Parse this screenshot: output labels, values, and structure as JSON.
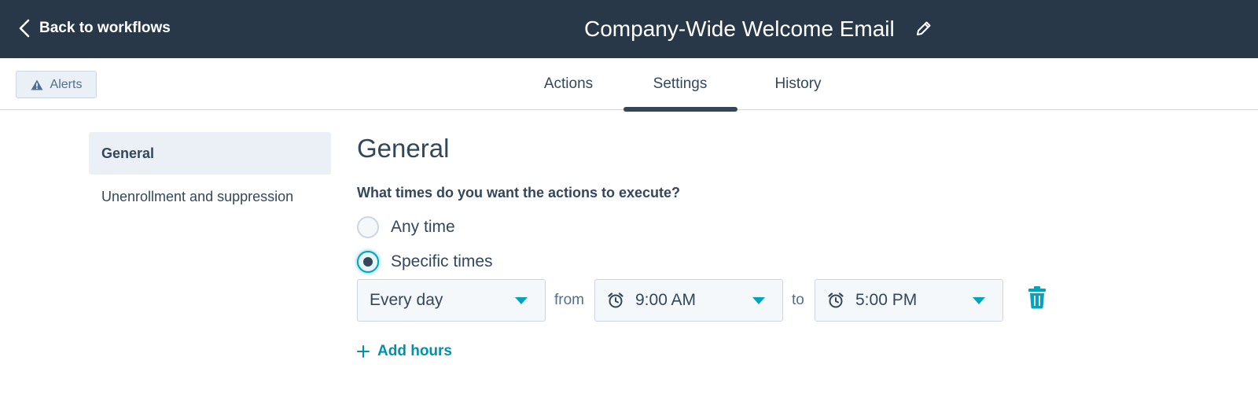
{
  "header": {
    "back_label": "Back to workflows",
    "title": "Company-Wide Welcome Email",
    "back_icon": "chevron-left-icon",
    "edit_icon": "pencil-icon"
  },
  "subnav": {
    "alerts_label": "Alerts",
    "alerts_icon": "warning-icon",
    "tabs": [
      {
        "label": "Actions",
        "active": false
      },
      {
        "label": "Settings",
        "active": true
      },
      {
        "label": "History",
        "active": false
      }
    ]
  },
  "sidebar": {
    "items": [
      {
        "label": "General",
        "active": true
      },
      {
        "label": "Unenrollment and suppression",
        "active": false
      }
    ]
  },
  "main": {
    "title": "General",
    "question": "What times do you want the actions to execute?",
    "options": [
      {
        "label": "Any time",
        "selected": false
      },
      {
        "label": "Specific times",
        "selected": true
      }
    ],
    "schedule": {
      "days_value": "Every day",
      "from_label": "from",
      "from_value": "9:00 AM",
      "to_label": "to",
      "to_value": "5:00 PM",
      "clock_icon": "alarm-clock-icon",
      "delete_icon": "trash-icon"
    },
    "add_hours_label": "Add hours",
    "add_icon": "plus-icon"
  },
  "colors": {
    "header_bg": "#283848",
    "text": "#33475b",
    "accent": "#00a4bd",
    "link": "#0091ae",
    "panel": "#eaf0f6",
    "border": "#cbd6e2"
  }
}
